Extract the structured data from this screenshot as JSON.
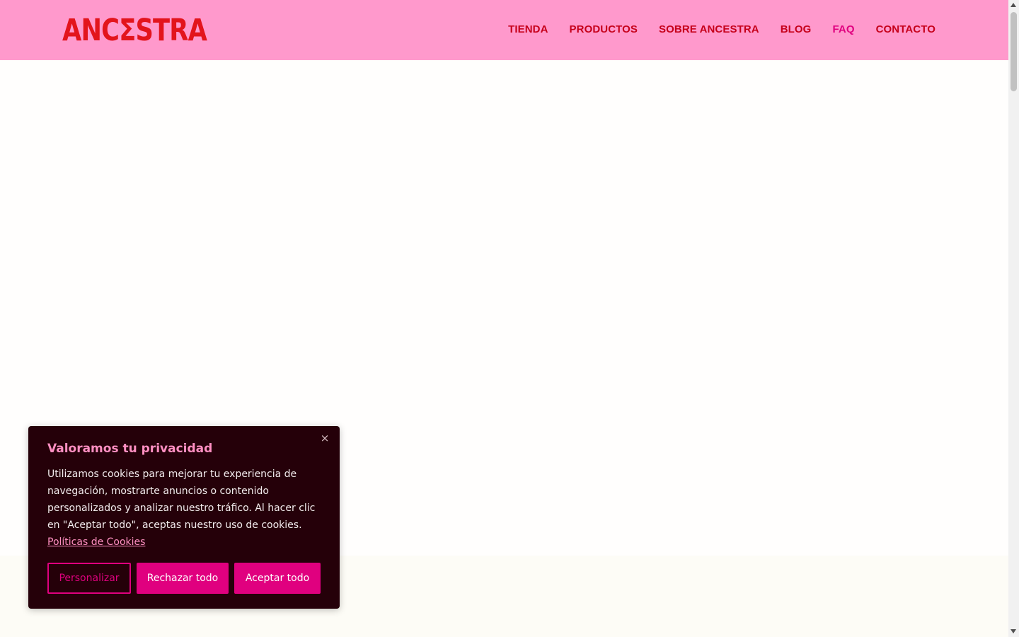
{
  "brand": {
    "logo_text": "ANCΣSTRA",
    "logo_color": "#e3141c",
    "header_bg": "#ff99cc"
  },
  "nav": {
    "items": [
      {
        "label": "TIENDA",
        "active": false
      },
      {
        "label": "PRODUCTOS",
        "active": false
      },
      {
        "label": "SOBRE ANCESTRA",
        "active": false
      },
      {
        "label": "BLOG",
        "active": false
      },
      {
        "label": "FAQ",
        "active": true
      },
      {
        "label": "CONTACTO",
        "active": false
      }
    ],
    "color": "#c6001a",
    "active_color": "#e0007f"
  },
  "cookie_banner": {
    "title": "Valoramos tu privacidad",
    "body": "Utilizamos cookies para mejorar tu experiencia de navegación, mostrarte anuncios o contenido personalizados y analizar nuestro tráfico. Al hacer clic en \"Aceptar todo\", aceptas nuestro uso de cookies.",
    "policy_link": "Políticas de Cookies",
    "close_icon": "×",
    "buttons": {
      "customize": "Personalizar",
      "reject": "Rechazar todo",
      "accept": "Aceptar todo"
    },
    "bg_color": "#250009",
    "accent_color": "#e0007f"
  }
}
